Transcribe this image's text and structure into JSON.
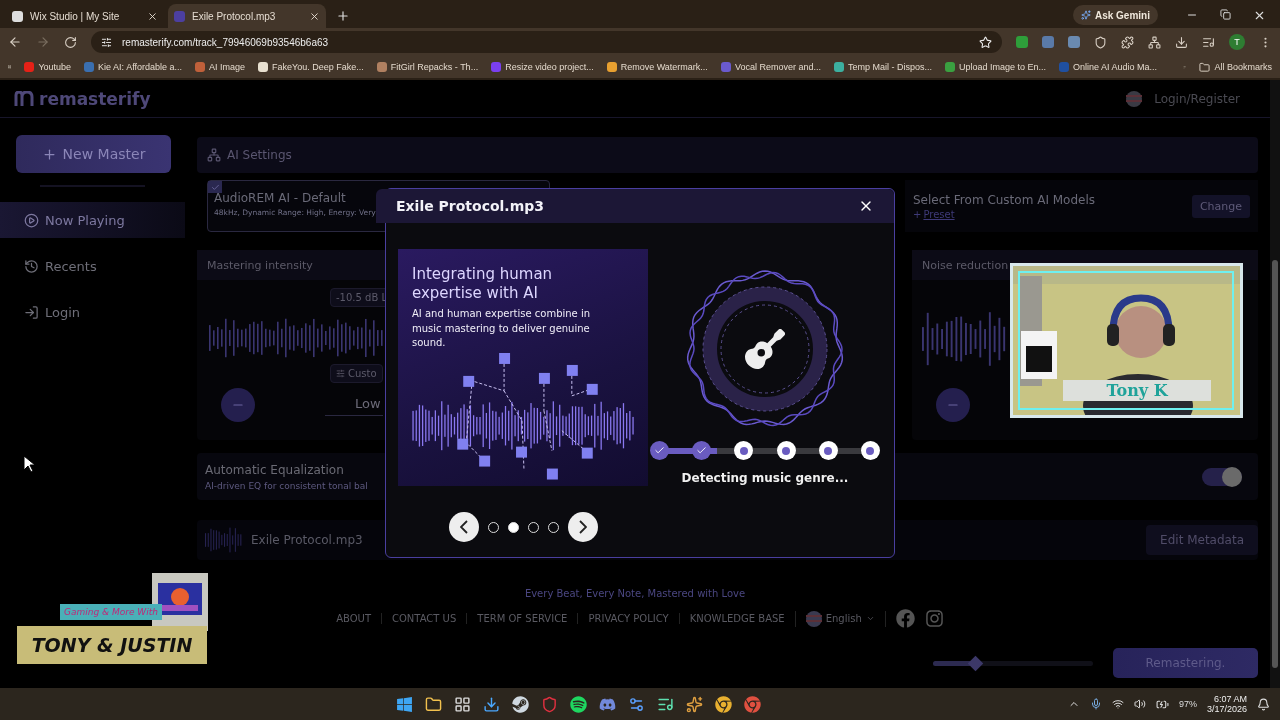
{
  "browser": {
    "tabs": [
      {
        "title": "Wix Studio | My Site",
        "selected": false
      },
      {
        "title": "Exile Protocol.mp3",
        "selected": true
      }
    ],
    "ask": "Ask Gemini",
    "url": "remasterify.com/track_79946069b93546b6a63",
    "profile": "T",
    "bookmarks": [
      {
        "label": "Youtube",
        "color": "#e62117"
      },
      {
        "label": "Kie AI: Affordable a...",
        "color": "#3a6fb0"
      },
      {
        "label": "AI Image",
        "color": "#c0603a"
      },
      {
        "label": "FakeYou. Deep Fake...",
        "color": "#e8e0d0"
      },
      {
        "label": "FitGirl Repacks - Th...",
        "color": "#b08060"
      },
      {
        "label": "Resize video project...",
        "color": "#7a3ff0"
      },
      {
        "label": "Remove Watermark...",
        "color": "#e8a030"
      },
      {
        "label": "Vocal Remover and...",
        "color": "#6a5acd"
      },
      {
        "label": "Temp Mail - Dispos...",
        "color": "#3cb0a0"
      },
      {
        "label": "Upload Image to En...",
        "color": "#3aa040"
      },
      {
        "label": "Online AI Audio Ma...",
        "color": "#2050a0"
      }
    ],
    "all_bookmarks": "All Bookmarks"
  },
  "site": {
    "logo": "remasterify",
    "login": "Login/Register",
    "new_master": "New Master",
    "nav": [
      {
        "label": "Now Playing",
        "kind": "play",
        "selected": true
      },
      {
        "label": "Recents",
        "kind": "recent",
        "selected": false
      },
      {
        "label": "Login",
        "kind": "login",
        "selected": false
      }
    ],
    "ai_settings": "AI Settings",
    "preset_card": {
      "title": "AudioREM AI - Default",
      "subtitle": "48kHz, Dynamic Range: High, Energy: Very",
      "checked": true
    },
    "custom_models": {
      "title": "Select From Custom AI Models",
      "plus": "+",
      "preset": "Preset",
      "button": "Change"
    },
    "mastering": {
      "title": "Mastering intensity",
      "reading": "-10.5 dB L",
      "custom": "Custo",
      "value": "Low"
    },
    "noise": {
      "title": "Noise reduction"
    },
    "eq": {
      "title": "Automatic Equalization",
      "subtitle": "AI-driven EQ for consistent tonal bal",
      "on": true
    },
    "file": {
      "name": "Exile Protocol.mp3",
      "button": "Edit Metadata"
    },
    "footer": {
      "tagline": "Every Beat, Every Note, Mastered with Love",
      "links": [
        "ABOUT",
        "CONTACT US",
        "TERM OF SERVICE",
        "PRIVACY POLICY",
        "KNOWLEDGE BASE"
      ],
      "language": "English"
    },
    "progress": {
      "level": 0.27,
      "button": "Remastering."
    }
  },
  "modal": {
    "title": "Exile Protocol.mp3",
    "slide": {
      "heading": "Integrating human expertise with AI",
      "body": "AI and human expertise combine in music mastering to deliver genuine sound."
    },
    "dots": [
      {
        "selected": false
      },
      {
        "selected": true
      },
      {
        "selected": false
      },
      {
        "selected": false
      }
    ],
    "steps": [
      {
        "done": true
      },
      {
        "done": true
      },
      {
        "done": false
      },
      {
        "done": false
      },
      {
        "done": false
      },
      {
        "done": false
      }
    ],
    "status": "Detecting music genre..."
  },
  "overlays": {
    "webcam_name": "Tony K",
    "logo_tagline": "Gaming & More With",
    "logo_title": "TONY & JUSTIN"
  },
  "taskbar": {
    "battery": "97%",
    "time": "6:07 AM",
    "date": "3/17/2026"
  }
}
